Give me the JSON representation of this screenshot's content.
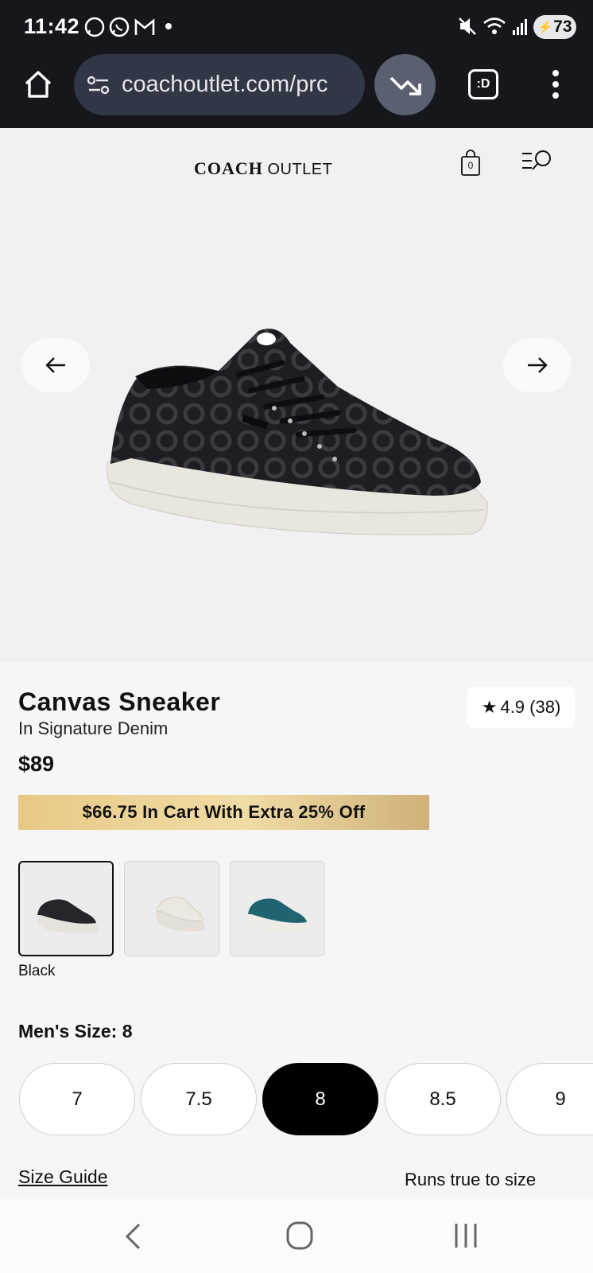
{
  "status_bar": {
    "time": "11:42",
    "battery": "73"
  },
  "browser": {
    "url": "coachoutlet.com/prc"
  },
  "site_header": {
    "brand": "COACH",
    "brand_suffix": "OUTLET",
    "cart_count": "0"
  },
  "product": {
    "title": "Canvas Sneaker",
    "subtitle": "In Signature Denim",
    "price": "$89",
    "rating": {
      "star": "★",
      "text": "4.9 (38)"
    },
    "promo": "$66.75 In Cart With Extra 25% Off",
    "colors": {
      "selected_name": "Black",
      "swatches": [
        "Black",
        "Chalk",
        "Teal"
      ]
    },
    "size_label": "Men's Size: 8",
    "sizes": [
      "7",
      "7.5",
      "8",
      "8.5",
      "9"
    ],
    "selected_size": "8",
    "size_guide": "Size Guide",
    "fit_note": "Runs true to size"
  },
  "colors": {
    "dark_bar": "#16171c",
    "url_pill": "#323746",
    "promo_gold": "#e8c985",
    "teal_shoe": "#1f6470"
  }
}
